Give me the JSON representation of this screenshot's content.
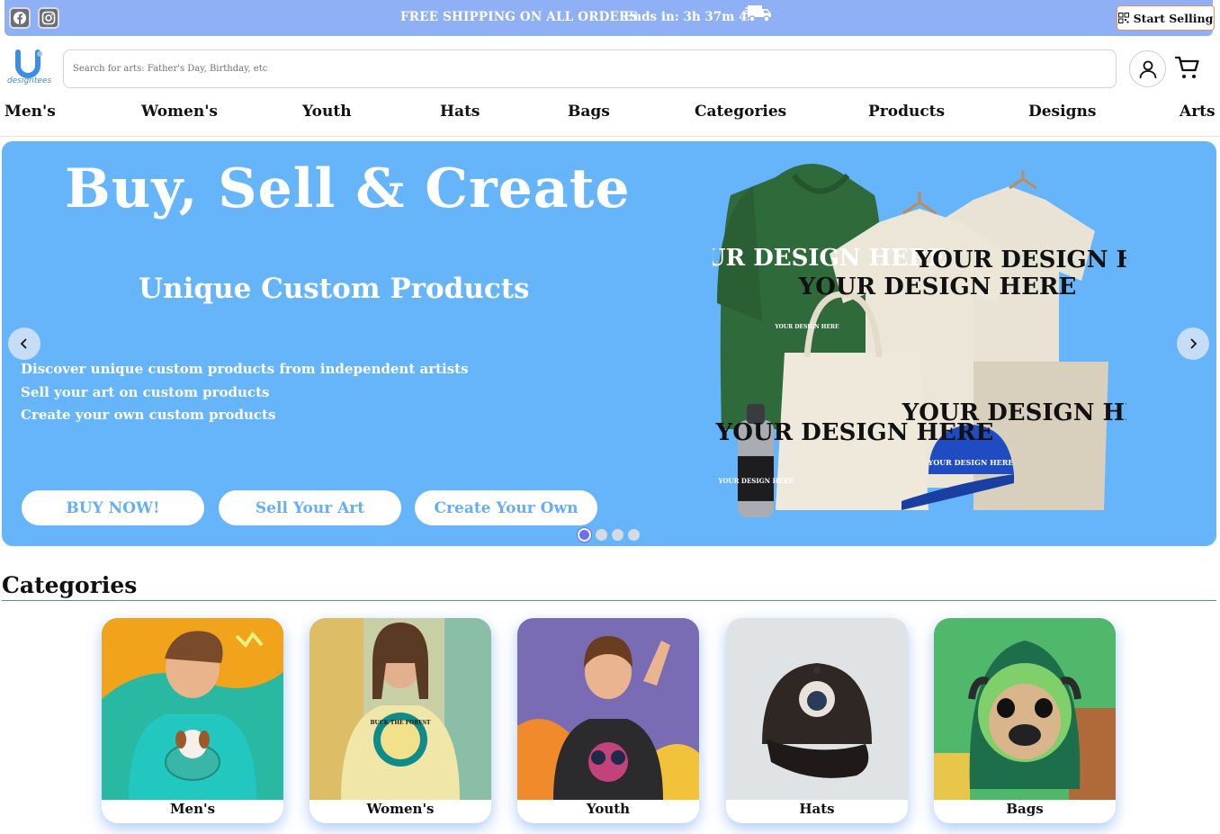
{
  "promo": {
    "shipping_text": "FREE SHIPPING ON ALL ORDERS",
    "timer_text": "Ends in: 3h 37m 4s",
    "start_selling_label": "Start Selling",
    "social_icons": [
      "facebook-icon",
      "instagram-icon"
    ]
  },
  "header": {
    "logo_text": "designtees",
    "search_placeholder": "Search for arts: Father's Day, Birthday, etc",
    "search_value": ""
  },
  "nav": {
    "items": [
      "Men's",
      "Women's",
      "Youth",
      "Hats",
      "Bags",
      "Categories",
      "Products",
      "Designs",
      "Arts"
    ]
  },
  "hero": {
    "title": "Buy, Sell & Create",
    "subtitle": "Unique Custom Products",
    "lines": [
      "Discover unique custom products from independent artists",
      "Sell your art on custom products",
      "Create your own custom products"
    ],
    "buttons": [
      "BUY NOW!",
      "Sell Your Art",
      "Create Your Own"
    ],
    "mockup_text": "YOUR DESIGN HERE",
    "mockup_small_text": "YOUR DESIGN HERE",
    "slide_count": 4,
    "active_slide": 1,
    "colors": {
      "background": "#66b5fb",
      "button_text": "#66aef7"
    }
  },
  "categories": {
    "heading": "Categories",
    "items": [
      {
        "label": "Men's"
      },
      {
        "label": "Women's",
        "shirt_text": "BUCK THE FOREST"
      },
      {
        "label": "Youth"
      },
      {
        "label": "Hats"
      },
      {
        "label": "Bags"
      }
    ]
  }
}
